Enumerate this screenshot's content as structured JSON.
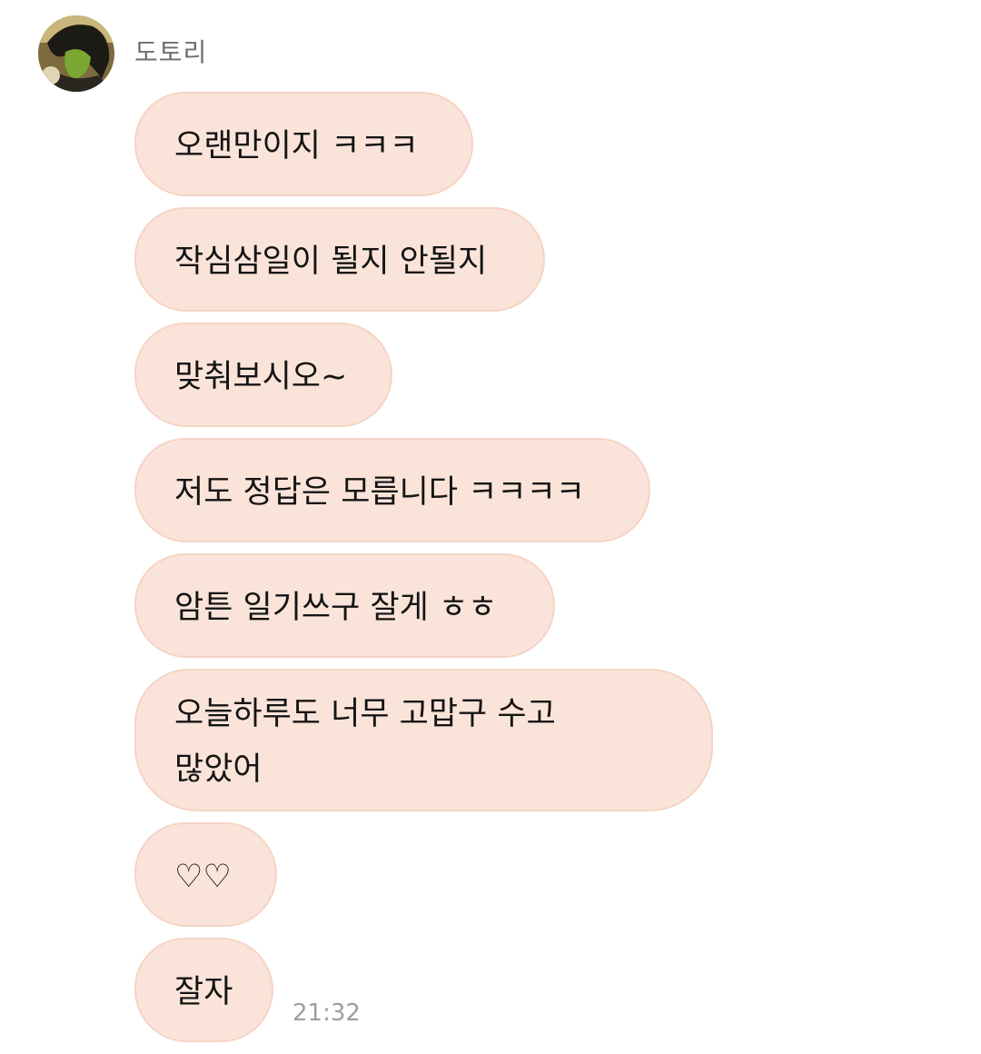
{
  "chat": {
    "sender": {
      "name": "도토리",
      "avatar_icon": "profile-photo"
    },
    "messages": [
      {
        "text": "오랜만이지 ㅋㅋㅋ"
      },
      {
        "text": "작심삼일이 될지 안될지"
      },
      {
        "text": "맞춰보시오~"
      },
      {
        "text": "저도 정답은 모릅니다 ㅋㅋㅋㅋ"
      },
      {
        "text": "암튼 일기쓰구 잘게 ㅎㅎ"
      },
      {
        "lines": [
          "오늘하루도 너무 고맙구 수고",
          "많았어"
        ]
      },
      {
        "text": "♡♡"
      },
      {
        "text": "잘자"
      }
    ],
    "last_time": "21:32"
  },
  "colors": {
    "bubble_bg": "#fae4da",
    "bubble_border": "#f6d4c5",
    "text": "#141414",
    "name": "#6d6d6d",
    "time": "#9e9e9e"
  }
}
